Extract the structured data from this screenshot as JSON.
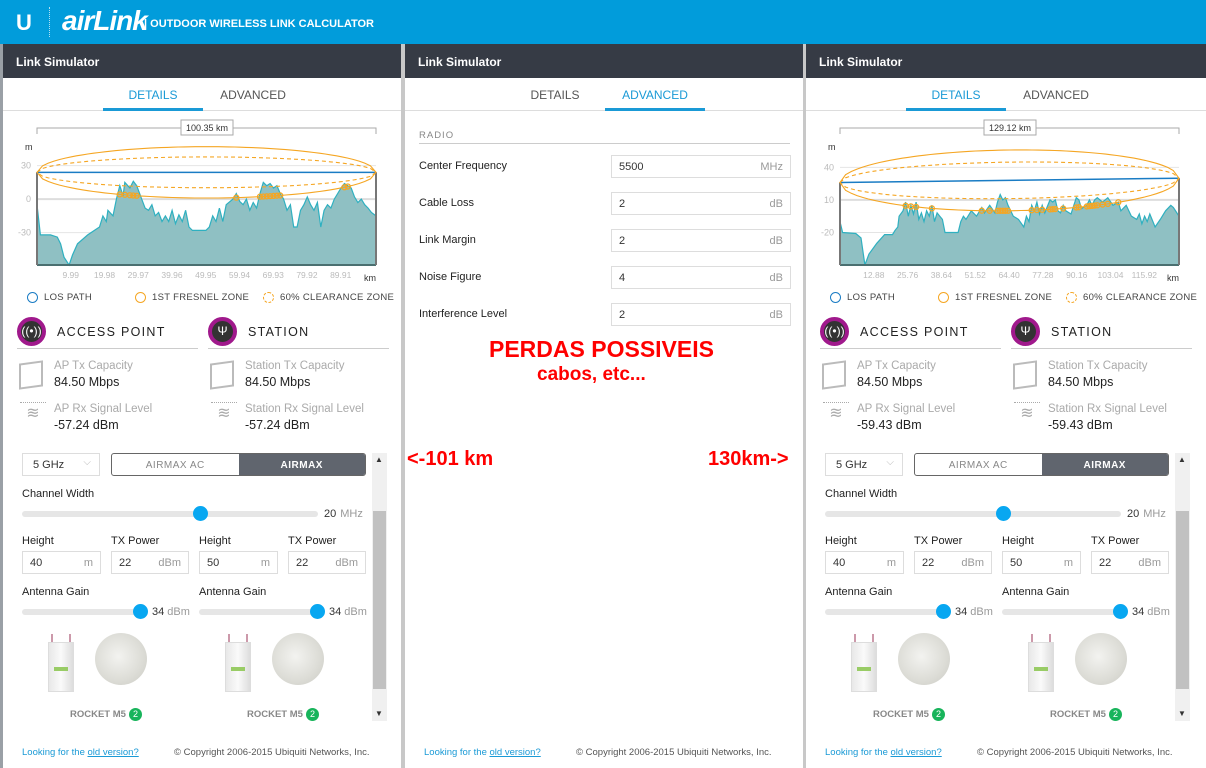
{
  "header": {
    "logo_mark": "U",
    "brand": "airLink",
    "subtitle": "| OUTDOOR WIRELESS LINK CALCULATOR",
    "bg_color": "#019cdb"
  },
  "panels": [
    {
      "title": "Link Simulator",
      "tabs": [
        "DETAILS",
        "ADVANCED"
      ],
      "active_tab": "DETAILS",
      "distance": "100.35 km",
      "legend": [
        "LOS PATH",
        "1ST FRESNEL ZONE",
        "60% CLEARANCE ZONE"
      ],
      "ap": {
        "heading": "ACCESS POINT",
        "tx_label": "AP Tx Capacity",
        "tx_value": "84.50 Mbps",
        "rx_label": "AP Rx Signal Level",
        "rx_value": "-57.24 dBm"
      },
      "station": {
        "heading": "STATION",
        "tx_label": "Station Tx Capacity",
        "tx_value": "84.50 Mbps",
        "rx_label": "Station Rx Signal Level",
        "rx_value": "-57.24 dBm"
      },
      "band": "5 GHz",
      "modes": [
        "AIRMAX AC",
        "AIRMAX"
      ],
      "active_mode": "AIRMAX",
      "channel_width": {
        "label": "Channel Width",
        "value": "20",
        "unit": "MHz",
        "fraction": 0.6
      },
      "ap_cfg": {
        "height_label": "Height",
        "height": "40",
        "height_unit": "m",
        "tx_label": "TX Power",
        "tx": "22",
        "tx_unit": "dBm",
        "gain_label": "Antenna Gain",
        "gain": "34",
        "gain_unit": "dBm",
        "gain_fraction": 1.0,
        "product": "ROCKET M5",
        "count": "2"
      },
      "st_cfg": {
        "height_label": "Height",
        "height": "50",
        "height_unit": "m",
        "tx_label": "TX Power",
        "tx": "22",
        "tx_unit": "dBm",
        "gain_label": "Antenna Gain",
        "gain": "34",
        "gain_unit": "dBm",
        "gain_fraction": 1.0,
        "product": "ROCKET M5",
        "count": "2"
      },
      "footer": {
        "link_prefix": "Looking for the ",
        "link": "old version?",
        "copyright": "© Copyright 2006-2015 Ubiquiti Networks, Inc."
      }
    },
    {
      "title": "Link Simulator",
      "tabs": [
        "DETAILS",
        "ADVANCED"
      ],
      "active_tab": "ADVANCED",
      "section": "RADIO",
      "fields": [
        {
          "label": "Center Frequency",
          "value": "5500",
          "unit": "MHz"
        },
        {
          "label": "Cable Loss",
          "value": "2",
          "unit": "dB"
        },
        {
          "label": "Link Margin",
          "value": "2",
          "unit": "dB"
        },
        {
          "label": "Noise Figure",
          "value": "4",
          "unit": "dB"
        },
        {
          "label": "Interference Level",
          "value": "2",
          "unit": "dB"
        }
      ],
      "footer": {
        "link_prefix": "Looking for the ",
        "link": "old version?",
        "copyright": "© Copyright 2006-2015 Ubiquiti Networks, Inc."
      }
    },
    {
      "title": "Link Simulator",
      "tabs": [
        "DETAILS",
        "ADVANCED"
      ],
      "active_tab": "DETAILS",
      "distance": "129.12 km",
      "legend": [
        "LOS PATH",
        "1ST FRESNEL ZONE",
        "60% CLEARANCE ZONE"
      ],
      "ap": {
        "heading": "ACCESS POINT",
        "tx_label": "AP Tx Capacity",
        "tx_value": "84.50 Mbps",
        "rx_label": "AP Rx Signal Level",
        "rx_value": "-59.43 dBm"
      },
      "station": {
        "heading": "STATION",
        "tx_label": "Station Tx Capacity",
        "tx_value": "84.50 Mbps",
        "rx_label": "Station Rx Signal Level",
        "rx_value": "-59.43 dBm"
      },
      "band": "5 GHz",
      "modes": [
        "AIRMAX AC",
        "AIRMAX"
      ],
      "active_mode": "AIRMAX",
      "channel_width": {
        "label": "Channel Width",
        "value": "20",
        "unit": "MHz",
        "fraction": 0.6
      },
      "ap_cfg": {
        "height_label": "Height",
        "height": "40",
        "height_unit": "m",
        "tx_label": "TX Power",
        "tx": "22",
        "tx_unit": "dBm",
        "gain_label": "Antenna Gain",
        "gain": "34",
        "gain_unit": "dBm",
        "gain_fraction": 1.0,
        "product": "ROCKET M5",
        "count": "2"
      },
      "st_cfg": {
        "height_label": "Height",
        "height": "50",
        "height_unit": "m",
        "tx_label": "TX Power",
        "tx": "22",
        "tx_unit": "dBm",
        "gain_label": "Antenna Gain",
        "gain": "34",
        "gain_unit": "dBm",
        "gain_fraction": 1.0,
        "product": "ROCKET M5",
        "count": "2"
      },
      "footer": {
        "link_prefix": "Looking for the ",
        "link": "old version?",
        "copyright": "© Copyright 2006-2015 Ubiquiti Networks, Inc."
      }
    }
  ],
  "annotations": {
    "title": "PERDAS POSSIVEIS",
    "subtitle": "cabos, etc...",
    "left": "<-101 km",
    "right": "130km->",
    "color": "#ff0000"
  },
  "chart_data": [
    {
      "type": "area",
      "ylabel": "m",
      "xlabel": "km",
      "xlim": [
        0,
        100.35
      ],
      "ylim": [
        -59,
        44
      ],
      "xticks": [
        "9.99",
        "19.98",
        "29.97",
        "39.96",
        "49.95",
        "59.94",
        "69.93",
        "79.92",
        "89.91"
      ],
      "yticks": [
        30,
        0,
        -30
      ],
      "los": [
        24,
        24
      ],
      "fresnel_radius": 23,
      "colors": {
        "terrain": "#8fc0c3",
        "terrain_line": "#2fb0c0",
        "los": "#1a7cc4",
        "fresnel": "#f5a623"
      },
      "terrain": [
        [
          0,
          -5
        ],
        [
          1,
          -32
        ],
        [
          4,
          -32
        ],
        [
          6,
          -34
        ],
        [
          7,
          -40
        ],
        [
          8,
          -52
        ],
        [
          9.5,
          -62
        ],
        [
          10.5,
          -50
        ],
        [
          12,
          -40
        ],
        [
          15,
          -32
        ],
        [
          17,
          -28
        ],
        [
          18.5,
          -25
        ],
        [
          19.5,
          -15
        ],
        [
          20.5,
          -20
        ],
        [
          21,
          -10
        ],
        [
          22.5,
          -15
        ],
        [
          23.5,
          0
        ],
        [
          24.5,
          12
        ],
        [
          25.5,
          3
        ],
        [
          26,
          15
        ],
        [
          27.5,
          10
        ],
        [
          28.5,
          16
        ],
        [
          29.5,
          12
        ],
        [
          31,
          0
        ],
        [
          32,
          -8
        ],
        [
          33,
          -10
        ],
        [
          34,
          -5
        ],
        [
          35,
          -15
        ],
        [
          36,
          -12
        ],
        [
          37,
          -20
        ],
        [
          38,
          -15
        ],
        [
          39,
          -20
        ],
        [
          40,
          -10
        ],
        [
          41,
          -22
        ],
        [
          42,
          -14
        ],
        [
          43,
          -20
        ],
        [
          44,
          -10
        ],
        [
          45,
          -25
        ],
        [
          46,
          -28
        ],
        [
          50,
          -28
        ],
        [
          51,
          -25
        ],
        [
          52,
          -15
        ],
        [
          53,
          -20
        ],
        [
          54,
          -8
        ],
        [
          55,
          -20
        ],
        [
          56,
          -5
        ],
        [
          58,
          0
        ],
        [
          59,
          5
        ],
        [
          60,
          -2
        ],
        [
          61,
          -5
        ],
        [
          62,
          0
        ],
        [
          63,
          -10
        ],
        [
          64,
          -3
        ],
        [
          65,
          -8
        ],
        [
          66,
          5
        ],
        [
          67,
          15
        ],
        [
          68,
          12
        ],
        [
          69,
          14
        ],
        [
          70,
          10
        ],
        [
          71,
          12
        ],
        [
          72,
          5
        ],
        [
          73,
          0
        ],
        [
          74,
          -10
        ],
        [
          75,
          -5
        ],
        [
          76,
          -25
        ],
        [
          77,
          -25
        ],
        [
          78,
          -10
        ],
        [
          79,
          -5
        ],
        [
          80,
          2
        ],
        [
          81,
          -5
        ],
        [
          82,
          -10
        ],
        [
          83,
          -3
        ],
        [
          84,
          -25
        ],
        [
          85,
          -10
        ],
        [
          86,
          -5
        ],
        [
          87,
          -8
        ],
        [
          88,
          0
        ],
        [
          89,
          5
        ],
        [
          90,
          10
        ],
        [
          91,
          14
        ],
        [
          92,
          12
        ],
        [
          93,
          10
        ],
        [
          94,
          2
        ],
        [
          95,
          -3
        ],
        [
          96,
          0
        ],
        [
          97,
          -5
        ],
        [
          98,
          -8
        ],
        [
          99,
          -12
        ],
        [
          100.35,
          -15
        ]
      ]
    },
    {
      "type": "area",
      "ylabel": "m",
      "xlabel": "km",
      "xlim": [
        0,
        129.12
      ],
      "ylim": [
        -50,
        56
      ],
      "xticks": [
        "12.88",
        "25.76",
        "38.64",
        "51.52",
        "64.40",
        "77.28",
        "90.16",
        "103.04",
        "115.92"
      ],
      "yticks": [
        40,
        10,
        -20
      ],
      "los": [
        26,
        30
      ],
      "fresnel_radius": 28,
      "colors": {
        "terrain": "#8fc0c3",
        "terrain_line": "#2fb0c0",
        "los": "#1a7cc4",
        "fresnel": "#f5a623"
      },
      "terrain": [
        [
          0,
          -10
        ],
        [
          1,
          -20
        ],
        [
          6,
          -21
        ],
        [
          8,
          -25
        ],
        [
          9.5,
          -50
        ],
        [
          11,
          -40
        ],
        [
          14,
          -30
        ],
        [
          17,
          -22
        ],
        [
          20,
          -22
        ],
        [
          21,
          -18
        ],
        [
          22,
          -15
        ],
        [
          22.5,
          -5
        ],
        [
          24,
          0
        ],
        [
          25,
          8
        ],
        [
          26,
          -5
        ],
        [
          27,
          5
        ],
        [
          28,
          -3
        ],
        [
          29,
          8
        ],
        [
          30,
          -8
        ],
        [
          31,
          -2
        ],
        [
          32,
          -10
        ],
        [
          33,
          0
        ],
        [
          34,
          -5
        ],
        [
          35,
          5
        ],
        [
          36,
          -10
        ],
        [
          37,
          -2
        ],
        [
          38,
          -5
        ],
        [
          39,
          -8
        ],
        [
          40,
          -20
        ],
        [
          45,
          -20
        ],
        [
          46,
          -10
        ],
        [
          47,
          -5
        ],
        [
          48,
          -8
        ],
        [
          50,
          0
        ],
        [
          52,
          -5
        ],
        [
          54,
          3
        ],
        [
          55,
          -2
        ],
        [
          57,
          5
        ],
        [
          59,
          -2
        ],
        [
          60,
          8
        ],
        [
          61,
          15
        ],
        [
          62,
          10
        ],
        [
          63,
          12
        ],
        [
          64,
          5
        ],
        [
          65,
          0
        ],
        [
          66,
          -5
        ],
        [
          68,
          -8
        ],
        [
          70,
          -15
        ],
        [
          71,
          -5
        ],
        [
          72,
          -10
        ],
        [
          73,
          5
        ],
        [
          74,
          0
        ],
        [
          75,
          8
        ],
        [
          76,
          -3
        ],
        [
          77,
          5
        ],
        [
          78,
          -2
        ],
        [
          80,
          10
        ],
        [
          81,
          8
        ],
        [
          82,
          10
        ],
        [
          83,
          0
        ],
        [
          84,
          -2
        ],
        [
          85,
          5
        ],
        [
          86,
          0
        ],
        [
          88,
          -3
        ],
        [
          90,
          12
        ],
        [
          91,
          10
        ],
        [
          92,
          2
        ],
        [
          94,
          5
        ],
        [
          95,
          10
        ],
        [
          96,
          5
        ],
        [
          97,
          10
        ],
        [
          98,
          12
        ],
        [
          100,
          8
        ],
        [
          102,
          12
        ],
        [
          104,
          5
        ],
        [
          106,
          8
        ],
        [
          107,
          0
        ],
        [
          109,
          5
        ],
        [
          111,
          -5
        ],
        [
          113,
          -8
        ],
        [
          114,
          -3
        ],
        [
          115,
          -12
        ],
        [
          116,
          -5
        ],
        [
          117,
          -10
        ],
        [
          118,
          -3
        ],
        [
          120,
          -15
        ],
        [
          122,
          -8
        ],
        [
          124,
          0
        ],
        [
          126,
          5
        ],
        [
          127,
          3
        ],
        [
          129.12,
          -5
        ]
      ]
    }
  ]
}
